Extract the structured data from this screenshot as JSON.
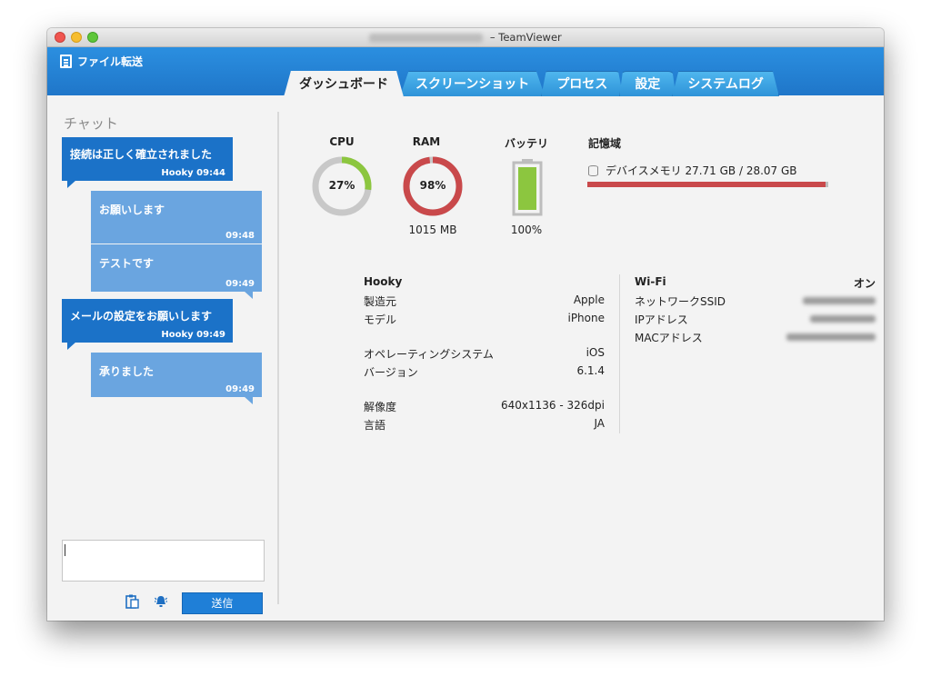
{
  "window": {
    "title_suffix": " – TeamViewer"
  },
  "header": {
    "file_transfer_label": "ファイル転送",
    "tabs": [
      {
        "label": "ダッシュボード",
        "active": true
      },
      {
        "label": "スクリーンショット",
        "active": false
      },
      {
        "label": "プロセス",
        "active": false
      },
      {
        "label": "設定",
        "active": false
      },
      {
        "label": "システムログ",
        "active": false
      }
    ]
  },
  "chat": {
    "title": "チャット",
    "messages": [
      {
        "text": "接続は正しく確立されました",
        "meta": "Hooky 09:44"
      },
      {
        "text": "お願いします",
        "meta": "09:48"
      },
      {
        "text": "テストです",
        "meta": "09:49"
      },
      {
        "text": "メールの設定をお願いします",
        "meta": "Hooky 09:49"
      },
      {
        "text": "承りました",
        "meta": "09:49"
      }
    ],
    "input_value": "",
    "send_label": "送信"
  },
  "dashboard": {
    "cpu": {
      "label": "CPU",
      "percent_text": "27%",
      "value": 0.27
    },
    "ram": {
      "label": "RAM",
      "percent_text": "98%",
      "value": 0.98,
      "sub": "1015 MB"
    },
    "battery": {
      "label": "バッテリ",
      "sub": "100%",
      "value": 1.0
    },
    "storage": {
      "title": "記憶域",
      "line": "デバイスメモリ 27.71 GB / 28.07 GB",
      "used_fraction": 0.987
    },
    "device": {
      "name": "Hooky",
      "rows": [
        {
          "k": "製造元",
          "v": "Apple"
        },
        {
          "k": "モデル",
          "v": "iPhone"
        },
        {
          "k": "オペレーティングシステム",
          "v": "iOS"
        },
        {
          "k": "バージョン",
          "v": "6.1.4"
        },
        {
          "k": "解像度",
          "v": "640x1136 - 326dpi"
        },
        {
          "k": "言語",
          "v": "JA"
        }
      ]
    },
    "network": {
      "wifi_label": "Wi-Fi",
      "wifi_value": "オン",
      "rows": [
        {
          "k": "ネットワークSSID"
        },
        {
          "k": "IPアドレス"
        },
        {
          "k": "MACアドレス"
        }
      ]
    }
  },
  "colors": {
    "accent": "#1f7fd7",
    "cpu_ring": "#8cc63f",
    "ram_ring": "#c9494b",
    "battery": "#8cc63f"
  }
}
